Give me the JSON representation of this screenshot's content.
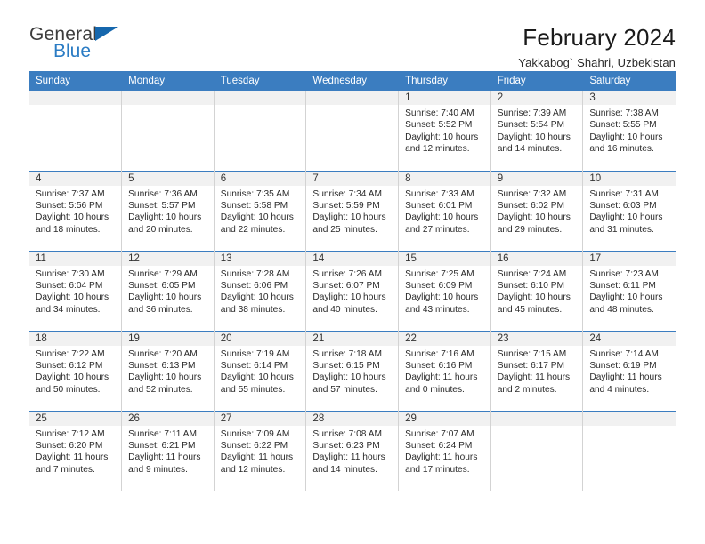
{
  "brand": {
    "name_top": "General",
    "name_bottom": "Blue",
    "accent_color": "#2b7cc4",
    "triangle_color": "#1667ad"
  },
  "header": {
    "title": "February 2024",
    "subtitle": "Yakkabog` Shahri, Uzbekistan"
  },
  "theme": {
    "header_row_bg": "#3b7dc0",
    "header_row_text": "#ffffff",
    "daynum_band_bg": "#f1f1f1",
    "row_separator": "#3b7dc0",
    "column_separator": "#d3d3d3"
  },
  "weekday_headers": [
    "Sunday",
    "Monday",
    "Tuesday",
    "Wednesday",
    "Thursday",
    "Friday",
    "Saturday"
  ],
  "weeks": [
    [
      {
        "day": "",
        "empty": true
      },
      {
        "day": "",
        "empty": true
      },
      {
        "day": "",
        "empty": true
      },
      {
        "day": "",
        "empty": true
      },
      {
        "day": "1",
        "sunrise": "Sunrise: 7:40 AM",
        "sunset": "Sunset: 5:52 PM",
        "daylight": "Daylight: 10 hours and 12 minutes."
      },
      {
        "day": "2",
        "sunrise": "Sunrise: 7:39 AM",
        "sunset": "Sunset: 5:54 PM",
        "daylight": "Daylight: 10 hours and 14 minutes."
      },
      {
        "day": "3",
        "sunrise": "Sunrise: 7:38 AM",
        "sunset": "Sunset: 5:55 PM",
        "daylight": "Daylight: 10 hours and 16 minutes."
      }
    ],
    [
      {
        "day": "4",
        "sunrise": "Sunrise: 7:37 AM",
        "sunset": "Sunset: 5:56 PM",
        "daylight": "Daylight: 10 hours and 18 minutes."
      },
      {
        "day": "5",
        "sunrise": "Sunrise: 7:36 AM",
        "sunset": "Sunset: 5:57 PM",
        "daylight": "Daylight: 10 hours and 20 minutes."
      },
      {
        "day": "6",
        "sunrise": "Sunrise: 7:35 AM",
        "sunset": "Sunset: 5:58 PM",
        "daylight": "Daylight: 10 hours and 22 minutes."
      },
      {
        "day": "7",
        "sunrise": "Sunrise: 7:34 AM",
        "sunset": "Sunset: 5:59 PM",
        "daylight": "Daylight: 10 hours and 25 minutes."
      },
      {
        "day": "8",
        "sunrise": "Sunrise: 7:33 AM",
        "sunset": "Sunset: 6:01 PM",
        "daylight": "Daylight: 10 hours and 27 minutes."
      },
      {
        "day": "9",
        "sunrise": "Sunrise: 7:32 AM",
        "sunset": "Sunset: 6:02 PM",
        "daylight": "Daylight: 10 hours and 29 minutes."
      },
      {
        "day": "10",
        "sunrise": "Sunrise: 7:31 AM",
        "sunset": "Sunset: 6:03 PM",
        "daylight": "Daylight: 10 hours and 31 minutes."
      }
    ],
    [
      {
        "day": "11",
        "sunrise": "Sunrise: 7:30 AM",
        "sunset": "Sunset: 6:04 PM",
        "daylight": "Daylight: 10 hours and 34 minutes."
      },
      {
        "day": "12",
        "sunrise": "Sunrise: 7:29 AM",
        "sunset": "Sunset: 6:05 PM",
        "daylight": "Daylight: 10 hours and 36 minutes."
      },
      {
        "day": "13",
        "sunrise": "Sunrise: 7:28 AM",
        "sunset": "Sunset: 6:06 PM",
        "daylight": "Daylight: 10 hours and 38 minutes."
      },
      {
        "day": "14",
        "sunrise": "Sunrise: 7:26 AM",
        "sunset": "Sunset: 6:07 PM",
        "daylight": "Daylight: 10 hours and 40 minutes."
      },
      {
        "day": "15",
        "sunrise": "Sunrise: 7:25 AM",
        "sunset": "Sunset: 6:09 PM",
        "daylight": "Daylight: 10 hours and 43 minutes."
      },
      {
        "day": "16",
        "sunrise": "Sunrise: 7:24 AM",
        "sunset": "Sunset: 6:10 PM",
        "daylight": "Daylight: 10 hours and 45 minutes."
      },
      {
        "day": "17",
        "sunrise": "Sunrise: 7:23 AM",
        "sunset": "Sunset: 6:11 PM",
        "daylight": "Daylight: 10 hours and 48 minutes."
      }
    ],
    [
      {
        "day": "18",
        "sunrise": "Sunrise: 7:22 AM",
        "sunset": "Sunset: 6:12 PM",
        "daylight": "Daylight: 10 hours and 50 minutes."
      },
      {
        "day": "19",
        "sunrise": "Sunrise: 7:20 AM",
        "sunset": "Sunset: 6:13 PM",
        "daylight": "Daylight: 10 hours and 52 minutes."
      },
      {
        "day": "20",
        "sunrise": "Sunrise: 7:19 AM",
        "sunset": "Sunset: 6:14 PM",
        "daylight": "Daylight: 10 hours and 55 minutes."
      },
      {
        "day": "21",
        "sunrise": "Sunrise: 7:18 AM",
        "sunset": "Sunset: 6:15 PM",
        "daylight": "Daylight: 10 hours and 57 minutes."
      },
      {
        "day": "22",
        "sunrise": "Sunrise: 7:16 AM",
        "sunset": "Sunset: 6:16 PM",
        "daylight": "Daylight: 11 hours and 0 minutes."
      },
      {
        "day": "23",
        "sunrise": "Sunrise: 7:15 AM",
        "sunset": "Sunset: 6:17 PM",
        "daylight": "Daylight: 11 hours and 2 minutes."
      },
      {
        "day": "24",
        "sunrise": "Sunrise: 7:14 AM",
        "sunset": "Sunset: 6:19 PM",
        "daylight": "Daylight: 11 hours and 4 minutes."
      }
    ],
    [
      {
        "day": "25",
        "sunrise": "Sunrise: 7:12 AM",
        "sunset": "Sunset: 6:20 PM",
        "daylight": "Daylight: 11 hours and 7 minutes."
      },
      {
        "day": "26",
        "sunrise": "Sunrise: 7:11 AM",
        "sunset": "Sunset: 6:21 PM",
        "daylight": "Daylight: 11 hours and 9 minutes."
      },
      {
        "day": "27",
        "sunrise": "Sunrise: 7:09 AM",
        "sunset": "Sunset: 6:22 PM",
        "daylight": "Daylight: 11 hours and 12 minutes."
      },
      {
        "day": "28",
        "sunrise": "Sunrise: 7:08 AM",
        "sunset": "Sunset: 6:23 PM",
        "daylight": "Daylight: 11 hours and 14 minutes."
      },
      {
        "day": "29",
        "sunrise": "Sunrise: 7:07 AM",
        "sunset": "Sunset: 6:24 PM",
        "daylight": "Daylight: 11 hours and 17 minutes."
      },
      {
        "day": "",
        "empty": true
      },
      {
        "day": "",
        "empty": true
      }
    ]
  ]
}
